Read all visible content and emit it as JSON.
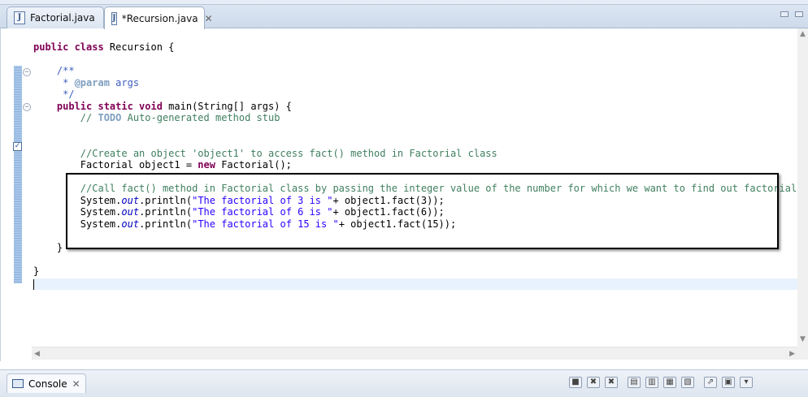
{
  "tabs": [
    {
      "label": "Factorial.java",
      "active": false,
      "icon": "java-file-icon"
    },
    {
      "label": "*Recursion.java",
      "active": true,
      "icon": "java-file-icon",
      "close": "✕"
    }
  ],
  "code_lines": [
    [
      {
        "t": "public class",
        "c": "kw"
      },
      {
        "t": " Recursion {",
        "c": ""
      }
    ],
    [],
    [
      {
        "t": "    /**",
        "c": "jd"
      }
    ],
    [
      {
        "t": "     * ",
        "c": "jd"
      },
      {
        "t": "@param",
        "c": "jdtag"
      },
      {
        "t": " args",
        "c": "jdparam"
      }
    ],
    [
      {
        "t": "     */",
        "c": "jd"
      }
    ],
    [
      {
        "t": "    ",
        "c": ""
      },
      {
        "t": "public static void",
        "c": "kw"
      },
      {
        "t": " main(String[] args) {",
        "c": ""
      }
    ],
    [
      {
        "t": "        // ",
        "c": "cm"
      },
      {
        "t": "TODO",
        "c": "todo"
      },
      {
        "t": " Auto-generated method stub",
        "c": "cm"
      }
    ],
    [],
    [],
    [
      {
        "t": "        //Create an object 'object1' to access fact() method in Factorial class",
        "c": "cm"
      }
    ],
    [
      {
        "t": "        Factorial object1 = ",
        "c": ""
      },
      {
        "t": "new",
        "c": "kw"
      },
      {
        "t": " Factorial();",
        "c": ""
      }
    ],
    [],
    [
      {
        "t": "        //Call fact() method in Factorial class by passing the integer value of the number for which we want to find out factorial",
        "c": "cm"
      }
    ],
    [
      {
        "t": "        System.",
        "c": ""
      },
      {
        "t": "out",
        "c": "fld"
      },
      {
        "t": ".println(",
        "c": ""
      },
      {
        "t": "\"The factorial of 3 is \"",
        "c": "str"
      },
      {
        "t": "+ object1.fact(3));",
        "c": ""
      }
    ],
    [
      {
        "t": "        System.",
        "c": ""
      },
      {
        "t": "out",
        "c": "fld"
      },
      {
        "t": ".println(",
        "c": ""
      },
      {
        "t": "\"The factorial of 6 is \"",
        "c": "str"
      },
      {
        "t": "+ object1.fact(6));",
        "c": ""
      }
    ],
    [
      {
        "t": "        System.",
        "c": ""
      },
      {
        "t": "out",
        "c": "fld"
      },
      {
        "t": ".println(",
        "c": ""
      },
      {
        "t": "\"The factorial of 15 is \"",
        "c": "str"
      },
      {
        "t": "+ object1.fact(15));",
        "c": ""
      }
    ],
    [],
    [
      {
        "t": "    }",
        "c": ""
      }
    ],
    [],
    [
      {
        "t": "}",
        "c": ""
      }
    ]
  ],
  "console": {
    "label": "Console",
    "close": "✕"
  }
}
